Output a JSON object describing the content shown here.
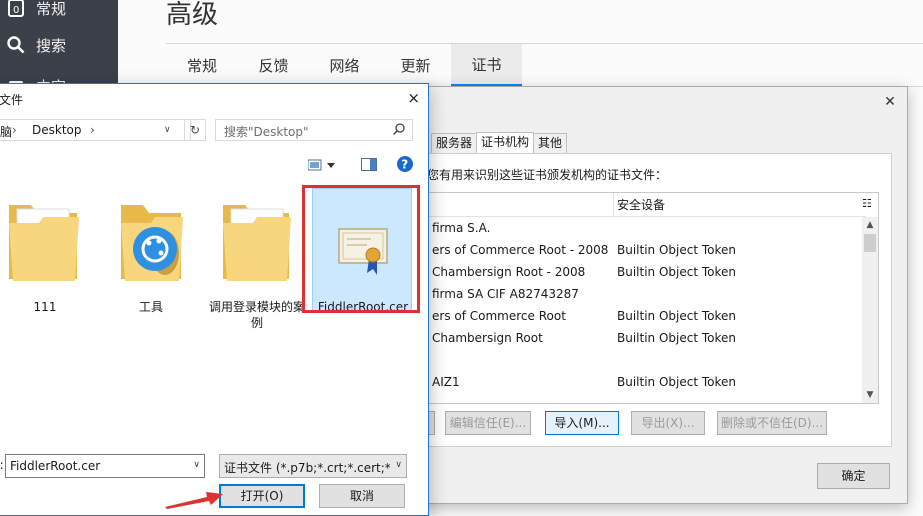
{
  "background": {
    "sidebar": {
      "items": [
        {
          "label": "常规",
          "icon": "general-icon"
        },
        {
          "label": "搜索",
          "icon": "search-icon"
        },
        {
          "label": "内容",
          "icon": "content-icon"
        }
      ]
    },
    "page_title": "高级",
    "tabs": [
      {
        "label": "常规"
      },
      {
        "label": "反馈"
      },
      {
        "label": "网络"
      },
      {
        "label": "更新"
      },
      {
        "label": "证书",
        "active": true
      }
    ]
  },
  "cert_manager": {
    "tabs": [
      "服务器",
      "证书机构",
      "其他"
    ],
    "active_tab": "证书机构",
    "description": "您有用来识别这些证书颁发机构的证书文件：",
    "column_security_device": "安全设备",
    "rows": [
      {
        "name": "firma S.A.",
        "device": ""
      },
      {
        "name": "ers of Commerce Root - 2008",
        "device": "Builtin Object Token"
      },
      {
        "name": "Chambersign Root - 2008",
        "device": "Builtin Object Token"
      },
      {
        "name": "firma SA CIF A82743287",
        "device": ""
      },
      {
        "name": "ers of Commerce Root",
        "device": "Builtin Object Token"
      },
      {
        "name": "Chambersign Root",
        "device": "Builtin Object Token"
      },
      {
        "name": "",
        "device": ""
      },
      {
        "name": "AIZ1",
        "device": "Builtin Object Token"
      }
    ],
    "buttons": {
      "edit_trust": "编辑信任(E)...",
      "import": "导入(M)...",
      "export": "导出(X)...",
      "delete_distrust": "删除或不信任(D)..."
    },
    "ok": "确定"
  },
  "file_dialog": {
    "title": "文件",
    "close": "×",
    "breadcrumb": [
      "脑",
      "Desktop"
    ],
    "search_placeholder": "搜索\"Desktop\"",
    "files": [
      {
        "name": "111",
        "type": "folder"
      },
      {
        "name": "工具",
        "type": "folder-app"
      },
      {
        "name": "调用登录模块的案例",
        "type": "folder"
      },
      {
        "name": "FiddlerRoot.cer",
        "type": "certificate",
        "selected": true
      }
    ],
    "filename_label": "):",
    "filename_value": "FiddlerRoot.cer",
    "filter_value": "证书文件 (*.p7b;*.crt;*.cert;*.c",
    "open_button": "打开(O)",
    "cancel_button": "取消"
  },
  "colors": {
    "highlight": "#e03131",
    "accent": "#0078d7",
    "sidebar_bg": "#3c4149",
    "selection_bg": "#cce8ff"
  }
}
